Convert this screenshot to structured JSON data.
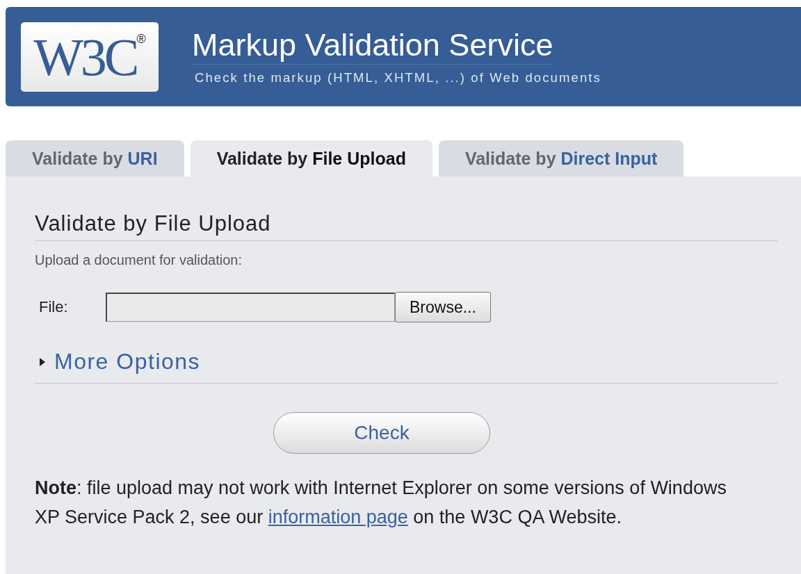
{
  "header": {
    "logo": {
      "text": "W3C",
      "mark": "®"
    },
    "title": "Markup Validation Service",
    "subtitle": "Check the markup (HTML, XHTML, ...) of Web documents"
  },
  "tabs": [
    {
      "prefix": "Validate by ",
      "label": "URI",
      "selected": false
    },
    {
      "prefix": "Validate by ",
      "label": "File Upload",
      "selected": true
    },
    {
      "prefix": "Validate by ",
      "label": "Direct Input",
      "selected": false
    }
  ],
  "panel": {
    "heading": "Validate by File Upload",
    "intro": "Upload a document for validation:",
    "file_label": "File:",
    "browse_button": "Browse...",
    "more_options": {
      "label": "More Options",
      "expanded": false
    },
    "check_button": "Check",
    "note": {
      "before": "**Note**: file upload may not work with Internet Explorer on some versions of Windows XP Service Pack 2, see our ",
      "link": "information page",
      "after": " on the W3C QA Website."
    }
  }
}
